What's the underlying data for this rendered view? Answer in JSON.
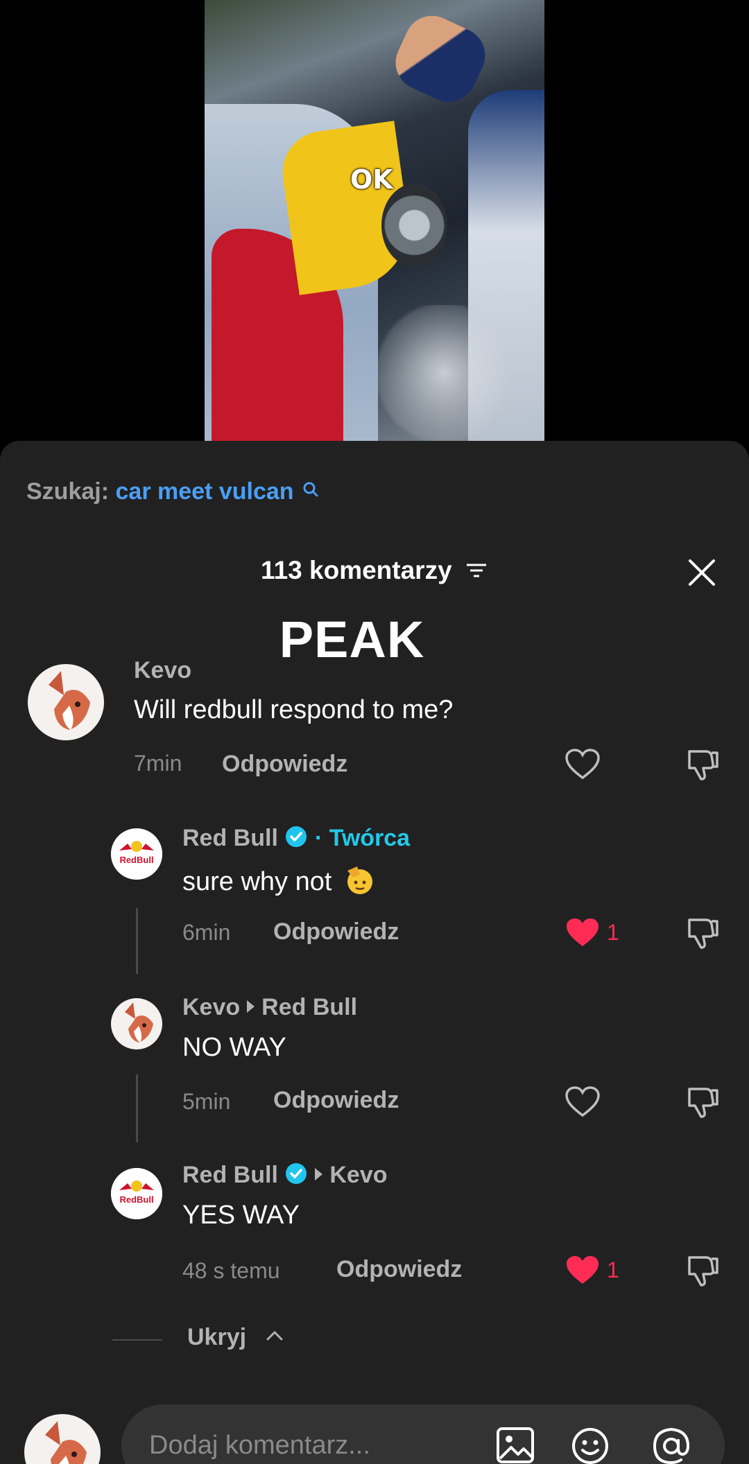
{
  "video": {
    "overlay_caption": "OK"
  },
  "search": {
    "label": "Szukaj:",
    "query": "car meet vulcan"
  },
  "comments_header": {
    "count_label": "113 komentarzy"
  },
  "overlay_text": "PEAK",
  "colors": {
    "sheet_bg": "#212121",
    "accent_blue": "#4a9ff5",
    "creator_cyan": "#24c8e8",
    "like_red": "#fe2c55"
  },
  "comments": [
    {
      "username": "Kevo",
      "text": "Will redbull respond to me?",
      "time": "7min",
      "reply_label": "Odpowiedz",
      "liked": false,
      "likes": ""
    }
  ],
  "replies": [
    {
      "username": "Red Bull",
      "verified": true,
      "creator_tag": "· Twórca",
      "text": "sure why not",
      "emoji": "saluting-face",
      "time": "6min",
      "reply_label": "Odpowiedz",
      "liked": true,
      "likes": "1"
    },
    {
      "username": "Kevo",
      "reply_to": "Red Bull",
      "text": "NO WAY",
      "time": "5min",
      "reply_label": "Odpowiedz",
      "liked": false,
      "likes": ""
    },
    {
      "username": "Red Bull",
      "verified": true,
      "reply_to": "Kevo",
      "text": "YES WAY",
      "time": "48 s temu",
      "reply_label": "Odpowiedz",
      "liked": true,
      "likes": "1"
    }
  ],
  "hide_label": "Ukryj",
  "input": {
    "placeholder": "Dodaj komentarz..."
  },
  "avatar_brand_text": "RedBull",
  "icons": [
    "search-icon",
    "filter-icon",
    "close-icon",
    "heart-icon",
    "dislike-icon",
    "verified-icon",
    "chevron-up-icon",
    "image-icon",
    "emoji-icon",
    "mention-icon"
  ]
}
